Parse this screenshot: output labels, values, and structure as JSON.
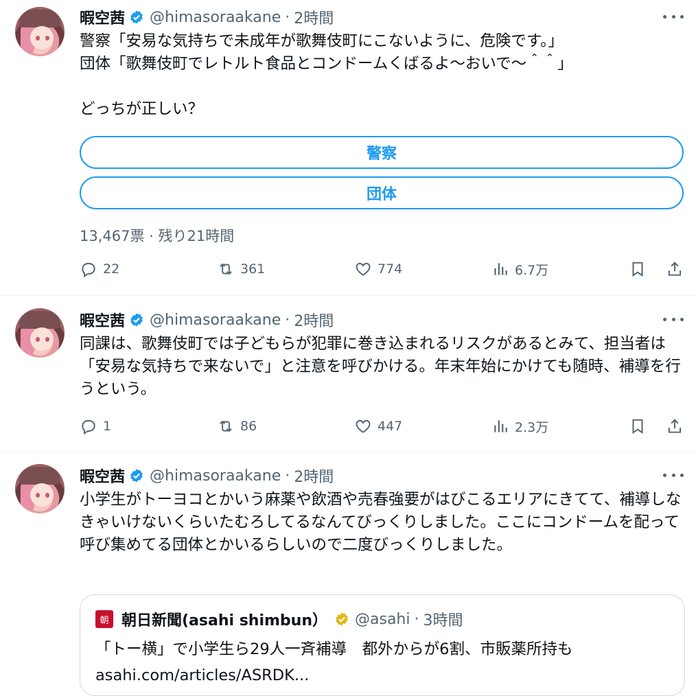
{
  "tweets": [
    {
      "author_name": "暇空茜",
      "handle": "@himasoraakane",
      "separator": "·",
      "time": "2時間",
      "text": "警察「安易な気持ちで未成年が歌舞伎町にこないように、危険です。」\n団体「歌舞伎町でレトルト食品とコンドームくばるよ〜おいで〜＾＾」\n\nどっちが正しい？",
      "poll": {
        "options": [
          "警察",
          "団体"
        ],
        "meta": "13,467票 · 残り21時間"
      },
      "stats": {
        "replies": "22",
        "retweets": "361",
        "likes": "774",
        "views": "6.7万"
      }
    },
    {
      "author_name": "暇空茜",
      "handle": "@himasoraakane",
      "separator": "·",
      "time": "2時間",
      "text": "同課は、歌舞伎町では子どもらが犯罪に巻き込まれるリスクがあるとみて、担当者は「安易な気持ちで来ないで」と注意を呼びかける。年末年始にかけても随時、補導を行うという。",
      "stats": {
        "replies": "1",
        "retweets": "86",
        "likes": "447",
        "views": "2.3万"
      }
    },
    {
      "author_name": "暇空茜",
      "handle": "@himasoraakane",
      "separator": "·",
      "time": "2時間",
      "text": "小学生がトーヨコとかいう麻薬や飲酒や売春強要がはびこるエリアにきてて、補導しなきゃいけないくらいたむろしてるなんてびっくりしました。ここにコンドームを配って呼び集めてる団体とかいるらしいので二度びっくりしました。",
      "quote": {
        "logo_text": "朝",
        "name": "朝日新聞(asahi shimbun）",
        "handle": "@asahi",
        "separator": "·",
        "time": "3時間",
        "text": "「トー横」で小学生ら29人一斉補導　都外からが6割、市販薬所持も\nasahi.com/articles/ASRDK..."
      }
    }
  ],
  "icons": {
    "reply": "reply-icon",
    "retweet": "retweet-icon",
    "like": "heart-icon",
    "views": "views-icon",
    "bookmark": "bookmark-icon",
    "share": "share-icon",
    "more": "more-icon",
    "verified": "verified-badge-icon"
  },
  "colors": {
    "accent": "#1d9bf0",
    "muted": "#536471",
    "verified_blue": "#1d9bf0",
    "verified_gold": "#e2b719",
    "asahi_red": "#c8102e"
  }
}
